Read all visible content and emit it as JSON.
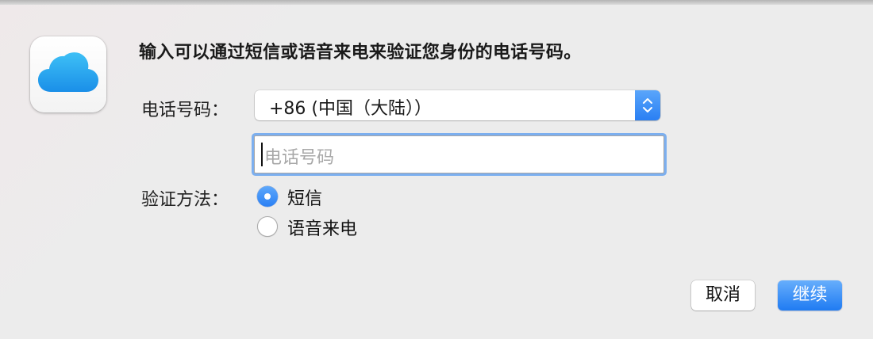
{
  "dialog": {
    "icon": "icloud-icon",
    "message": "输入可以通过短信或语音来电来验证您身份的电话号码。"
  },
  "form": {
    "phone_label": "电话号码：",
    "country_select": {
      "value": "+86 (中国（大陆））"
    },
    "phone_input": {
      "value": "",
      "placeholder": "电话号码"
    },
    "method_label": "验证方法：",
    "methods": [
      {
        "label": "短信",
        "selected": true
      },
      {
        "label": "语音来电",
        "selected": false
      }
    ]
  },
  "buttons": {
    "cancel": "取消",
    "continue": "继续"
  },
  "colors": {
    "accent": "#2a80f4",
    "focus_ring": "#69a4f0"
  }
}
